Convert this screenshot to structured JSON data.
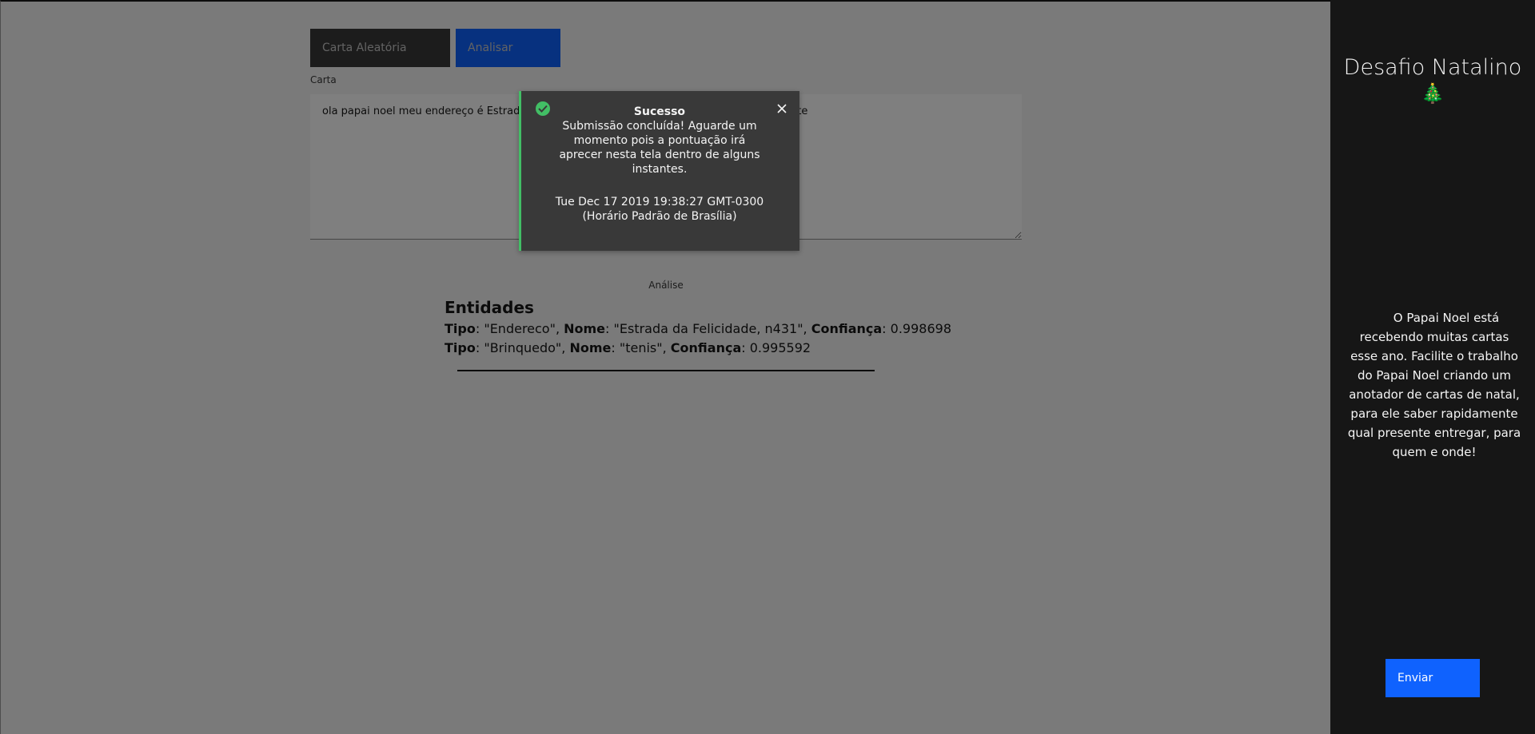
{
  "toolbar": {
    "random_label": "Carta Aleatória",
    "analyze_label": "Analisar"
  },
  "form": {
    "carta_label": "Carta",
    "carta_value": "ola papai noel meu endereço é Estrada da Felicidade, n431, e eu quero um tenis de presente"
  },
  "analysis": {
    "section_label": "Análise",
    "entities_title": "Entidades",
    "field_labels": {
      "tipo": "Tipo",
      "nome": "Nome",
      "confianca": "Confiança"
    },
    "entities": [
      {
        "tipo": "\"Endereco\"",
        "nome": "\"Estrada da Felicidade, n431\"",
        "confianca": "0.998698"
      },
      {
        "tipo": "\"Brinquedo\"",
        "nome": "\"tenis\"",
        "confianca": "0.995592"
      }
    ]
  },
  "sidebar": {
    "title": "Desafio Natalino",
    "title_icon": "🎄",
    "description": "O Papai Noel está recebendo muitas cartas esse ano. Facilite o trabalho do Papai Noel criando um anotador de cartas de natal, para ele saber rapidamente qual presente entregar, para quem e onde!",
    "send_label": "Enviar"
  },
  "toast": {
    "kind": "success",
    "icon": "checkmark-filled-icon",
    "title": "Sucesso",
    "subtitle": "Submissão concluída! Aguarde um momento pois a pontuação irá aprecer nesta tela dentro de alguns instantes.",
    "caption": "Tue Dec 17 2019 19:38:27 GMT-0300 (Horário Padrão de Brasília)"
  },
  "colors": {
    "primary": "#0f62fe",
    "success": "#42be65",
    "dark": "#161616",
    "toast_bg": "#393939"
  }
}
